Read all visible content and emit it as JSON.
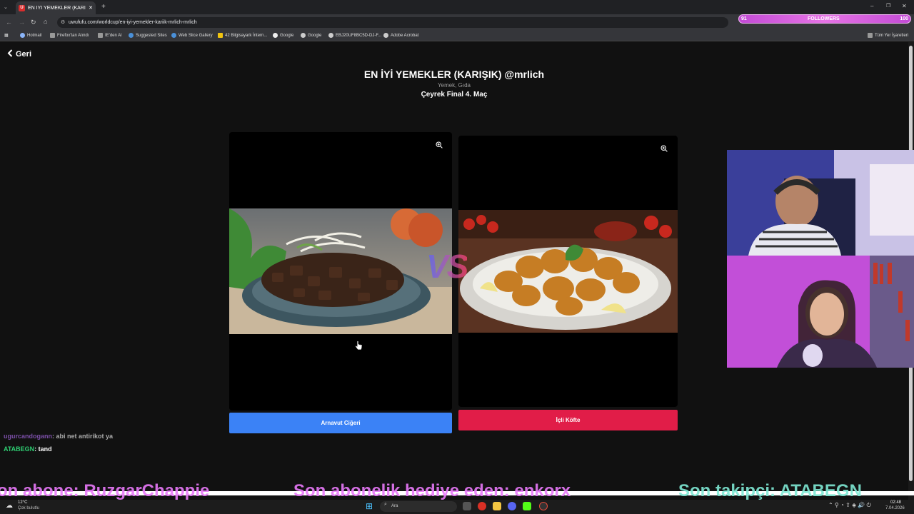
{
  "browser": {
    "tab_title": "EN İYİ YEMEKLER (KARIŞIK) @...",
    "url": "uwufufu.com/worldcup/en-iyi-yemekler-kariik-mrlich-mrlich",
    "bookmarks": [
      "Hotmail",
      "Firefox'tan Alındı",
      "IE'den Al",
      "Suggested Sites",
      "Web Slice Gallery",
      "42 Bilgisayark İntern...",
      "Google",
      "Google",
      "EBJ20UF8BC5D-DJ-F...",
      "Adobe Acrobat"
    ],
    "all_bookmarks": "Tüm Yer İşaretleri"
  },
  "followers": {
    "current": "91",
    "label": "FOLLOWERS",
    "goal": "100"
  },
  "page": {
    "back_label": "Geri",
    "title": "EN İYİ YEMEKLER (KARIŞIK) @mrlich",
    "subtitle": "Yemek, Gıda",
    "round": "Çeyrek Final 4. Maç",
    "vs": "VS",
    "left_choice": "Arnavut Ciğeri",
    "right_choice": "İçli Köfte"
  },
  "chat": [
    {
      "user": "ugurcandogann",
      "message": ": abi net antirikot ya",
      "color": "#7b4fa8"
    },
    {
      "user": "ATABEGN",
      "message": ": tand",
      "color": "#2ecc71"
    }
  ],
  "ticker": {
    "last_sub": "on abone: RuzgarChappie",
    "last_gift": "Son abonelik hediye eden: enkorx",
    "last_follow": "Son takipçi: ATABEGN"
  },
  "taskbar": {
    "weather_temp": "12°C",
    "weather_desc": "Çok bulutlu",
    "search_placeholder": "Ara",
    "time": "02:48",
    "date": "7.04.2026"
  },
  "colors": {
    "blue_button": "#3b82f6",
    "red_button": "#e11d48",
    "ticker_pink": "#e879f9",
    "ticker_teal": "#7ee8d4"
  }
}
